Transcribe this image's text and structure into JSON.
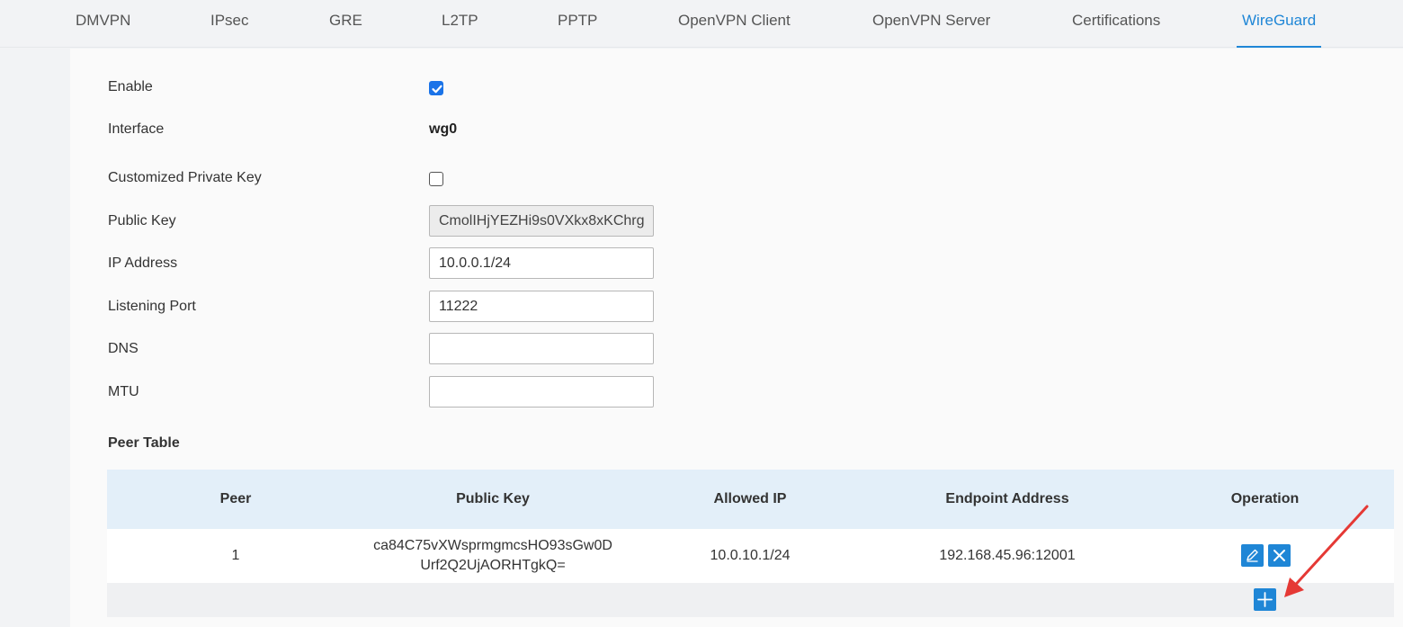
{
  "tabs": [
    {
      "label": "DMVPN"
    },
    {
      "label": "IPsec"
    },
    {
      "label": "GRE"
    },
    {
      "label": "L2TP"
    },
    {
      "label": "PPTP"
    },
    {
      "label": "OpenVPN Client"
    },
    {
      "label": "OpenVPN Server"
    },
    {
      "label": "Certifications"
    },
    {
      "label": "WireGuard",
      "active": true
    }
  ],
  "form": {
    "enable": {
      "label": "Enable",
      "checked": true
    },
    "interface": {
      "label": "Interface",
      "value": "wg0"
    },
    "customized_private_key": {
      "label": "Customized Private Key",
      "checked": false
    },
    "public_key": {
      "label": "Public Key",
      "value": "CmolIHjYEZHi9s0VXkx8xKChrg"
    },
    "ip_address": {
      "label": "IP Address",
      "value": "10.0.0.1/24"
    },
    "listening_port": {
      "label": "Listening Port",
      "value": "11222"
    },
    "dns": {
      "label": "DNS",
      "value": ""
    },
    "mtu": {
      "label": "MTU",
      "value": ""
    }
  },
  "peer_table": {
    "title": "Peer Table",
    "columns": [
      "Peer",
      "Public Key",
      "Allowed IP",
      "Endpoint Address",
      "Operation"
    ],
    "rows": [
      {
        "peer": "1",
        "public_key_line1": "ca84C75vXWsprmgmcsHO93sGw0D",
        "public_key_line2": "Urf2Q2UjAORHTgkQ=",
        "allowed_ip": "10.0.10.1/24",
        "endpoint": "192.168.45.96:12001"
      }
    ]
  },
  "icons": {
    "edit": "pencil-icon",
    "delete": "close-icon",
    "add": "plus-icon",
    "check": "check-icon"
  },
  "colors": {
    "accent": "#1f86d6",
    "checkbox_checked": "#1a73e8",
    "table_header_bg": "#e3eff9",
    "annotation_arrow": "#e53935"
  }
}
